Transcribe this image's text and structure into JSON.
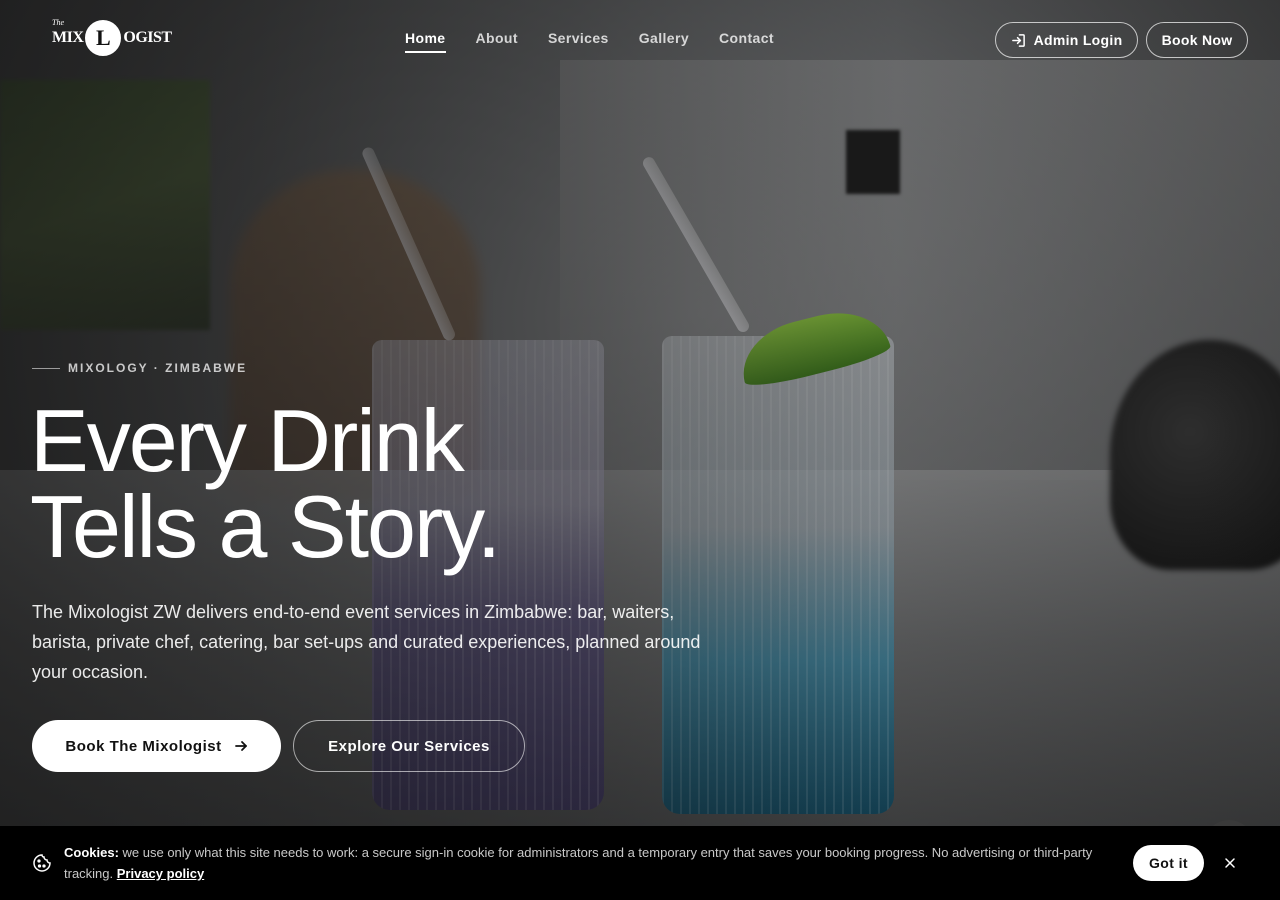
{
  "brand": {
    "logo_prefix": "The",
    "logo_left": "MIX",
    "logo_circle": "L",
    "logo_right": "OGIST"
  },
  "nav": {
    "items": [
      {
        "label": "Home",
        "active": true
      },
      {
        "label": "About",
        "active": false
      },
      {
        "label": "Services",
        "active": false
      },
      {
        "label": "Gallery",
        "active": false
      },
      {
        "label": "Contact",
        "active": false
      }
    ],
    "admin_login": "Admin Login",
    "book_now": "Book Now"
  },
  "hero": {
    "eyebrow": "MIXOLOGY · ZIMBABWE",
    "headline_line1": "Every Drink",
    "headline_line2": "Tells a Story.",
    "lead": "The Mixologist ZW delivers end-to-end event services in Zimbabwe: bar, waiters, barista, private chef, catering, bar set-ups and curated experiences, planned around your occasion.",
    "cta_primary": "Book The Mixologist",
    "cta_secondary": "Explore Our Services"
  },
  "cookie": {
    "label": "Cookies:",
    "text": " we use only what this site needs to work: a secure sign-in cookie for administrators and a temporary entry that saves your booking progress. No advertising or third-party tracking. ",
    "link": "Privacy policy",
    "accept": "Got it"
  },
  "icons": {
    "login": "login-icon",
    "arrow": "arrow-right-icon",
    "cookie": "cookie-icon",
    "close": "close-icon"
  }
}
